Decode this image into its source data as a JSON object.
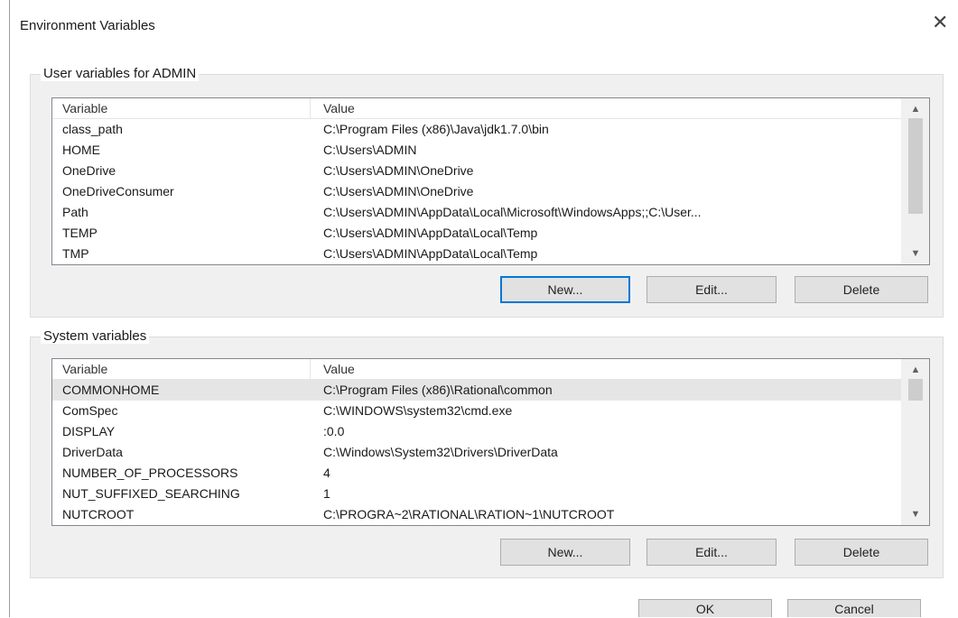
{
  "dialog": {
    "title": "Environment Variables",
    "close_glyph": "✕"
  },
  "user_vars": {
    "label": "User variables for ADMIN",
    "columns": {
      "variable": "Variable",
      "value": "Value"
    },
    "rows": [
      {
        "variable": "class_path",
        "value": "C:\\Program Files (x86)\\Java\\jdk1.7.0\\bin"
      },
      {
        "variable": "HOME",
        "value": "C:\\Users\\ADMIN"
      },
      {
        "variable": "OneDrive",
        "value": "C:\\Users\\ADMIN\\OneDrive"
      },
      {
        "variable": "OneDriveConsumer",
        "value": "C:\\Users\\ADMIN\\OneDrive"
      },
      {
        "variable": "Path",
        "value": "C:\\Users\\ADMIN\\AppData\\Local\\Microsoft\\WindowsApps;;C:\\User..."
      },
      {
        "variable": "TEMP",
        "value": "C:\\Users\\ADMIN\\AppData\\Local\\Temp"
      },
      {
        "variable": "TMP",
        "value": "C:\\Users\\ADMIN\\AppData\\Local\\Temp"
      }
    ],
    "buttons": {
      "new": "New...",
      "edit": "Edit...",
      "delete": "Delete"
    }
  },
  "system_vars": {
    "label": "System variables",
    "columns": {
      "variable": "Variable",
      "value": "Value"
    },
    "rows": [
      {
        "variable": "COMMONHOME",
        "value": "C:\\Program Files (x86)\\Rational\\common"
      },
      {
        "variable": "ComSpec",
        "value": "C:\\WINDOWS\\system32\\cmd.exe"
      },
      {
        "variable": "DISPLAY",
        "value": ":0.0"
      },
      {
        "variable": "DriverData",
        "value": "C:\\Windows\\System32\\Drivers\\DriverData"
      },
      {
        "variable": "NUMBER_OF_PROCESSORS",
        "value": "4"
      },
      {
        "variable": "NUT_SUFFIXED_SEARCHING",
        "value": "1"
      },
      {
        "variable": "NUTCROOT",
        "value": "C:\\PROGRA~2\\RATIONAL\\RATION~1\\NUTCROOT"
      }
    ],
    "buttons": {
      "new": "New...",
      "edit": "Edit...",
      "delete": "Delete"
    }
  },
  "footer": {
    "ok": "OK",
    "cancel": "Cancel"
  },
  "scroll_glyphs": {
    "up": "▲",
    "down": "▼"
  }
}
